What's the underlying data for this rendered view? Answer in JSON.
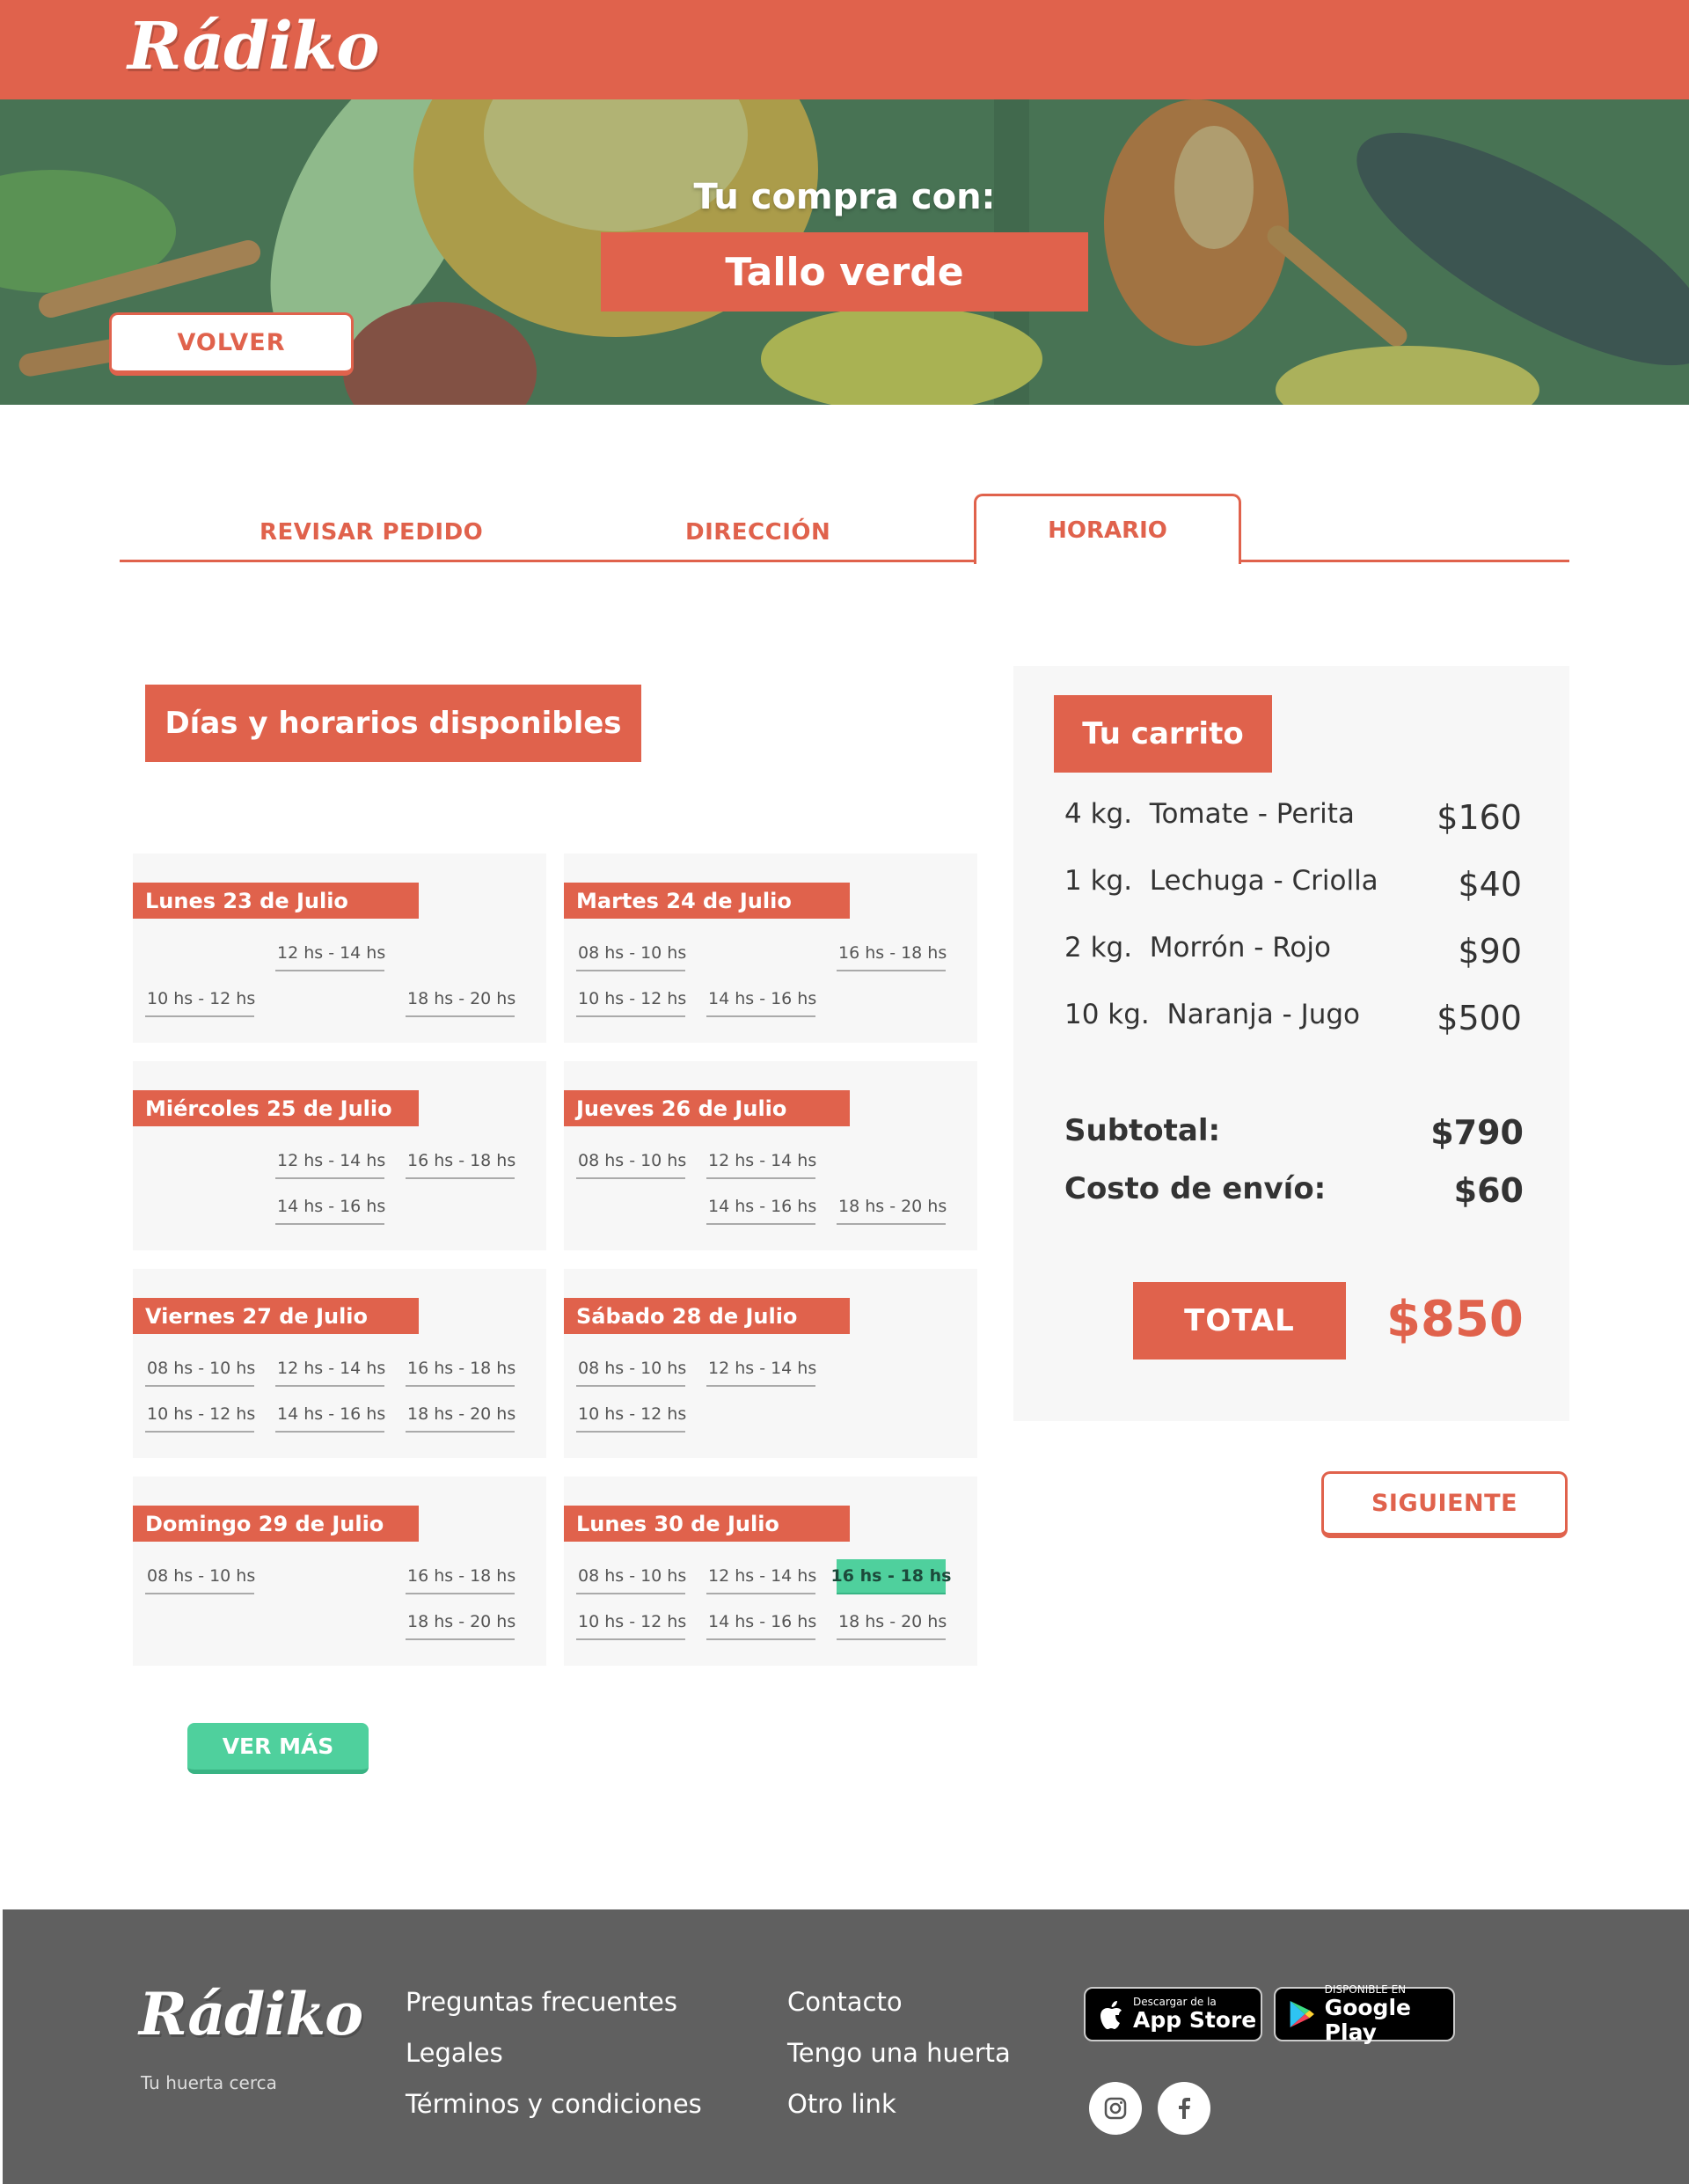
{
  "brand": {
    "name": "Rádiko",
    "tagline": "Tu huerta cerca"
  },
  "hero": {
    "subtitle": "Tu compra con:",
    "store": "Tallo verde",
    "back_label": "VOLVER"
  },
  "tabs": [
    {
      "label": "REVISAR PEDIDO",
      "active": false
    },
    {
      "label": "DIRECCIÓN",
      "active": false
    },
    {
      "label": "HORARIO",
      "active": true
    }
  ],
  "schedule": {
    "title": "Días y horarios disponibles",
    "more_label": "VER MÁS",
    "days": [
      {
        "label": "Lunes 23 de Julio",
        "slots": [
          "12 hs - 14 hs",
          "10 hs - 12 hs",
          "18 hs - 20 hs"
        ]
      },
      {
        "label": "Martes 24 de Julio",
        "slots": [
          "08 hs - 10 hs",
          "16 hs - 18 hs",
          "10 hs - 12 hs",
          "14 hs - 16 hs"
        ]
      },
      {
        "label": "Miércoles 25 de Julio",
        "slots": [
          "12 hs - 14 hs",
          "16 hs - 18 hs",
          "14 hs - 16 hs"
        ]
      },
      {
        "label": "Jueves 26 de Julio",
        "slots": [
          "08 hs - 10 hs",
          "12 hs - 14 hs",
          "14 hs - 16 hs",
          "18 hs - 20 hs"
        ]
      },
      {
        "label": "Viernes 27 de Julio",
        "slots": [
          "08 hs - 10 hs",
          "12 hs - 14 hs",
          "16 hs - 18 hs",
          "10 hs - 12 hs",
          "14 hs - 16 hs",
          "18 hs - 20 hs"
        ]
      },
      {
        "label": "Sábado 28 de Julio",
        "slots": [
          "08 hs - 10 hs",
          "12 hs - 14 hs",
          "10 hs - 12 hs"
        ]
      },
      {
        "label": "Domingo 29 de Julio",
        "slots": [
          "08 hs - 10 hs",
          "16 hs - 18 hs",
          "18 hs - 20 hs"
        ]
      },
      {
        "label": "Lunes 30 de Julio",
        "slots": [
          "08 hs - 10 hs",
          "12 hs - 14 hs",
          "16 hs - 18 hs",
          "10 hs - 12 hs",
          "14 hs - 16 hs",
          "18 hs - 20 hs"
        ],
        "selected": "16 hs - 18 hs"
      }
    ]
  },
  "cart": {
    "title": "Tu carrito",
    "items": [
      {
        "qty": "4 kg.",
        "name": "Tomate - Perita",
        "price": "$160"
      },
      {
        "qty": "1 kg.",
        "name": "Lechuga - Criolla",
        "price": "$40"
      },
      {
        "qty": "2 kg.",
        "name": "Morrón - Rojo",
        "price": "$90"
      },
      {
        "qty": "10 kg.",
        "name": "Naranja - Jugo",
        "price": "$500"
      }
    ],
    "subtotal_label": "Subtotal:",
    "subtotal": "$790",
    "shipping_label": "Costo de envío:",
    "shipping": "$60",
    "total_label": "TOTAL",
    "total": "$850",
    "next_label": "SIGUIENTE"
  },
  "footer": {
    "col1": [
      "Preguntas frecuentes",
      "Legales",
      "Términos y condiciones"
    ],
    "col2": [
      "Contacto",
      "Tengo una huerta",
      "Otro link"
    ],
    "app_store": {
      "small": "Descargar de la",
      "big": "App Store"
    },
    "google_play": {
      "small": "DISPONIBLE EN",
      "big": "Google Play"
    },
    "social": [
      "instagram-icon",
      "facebook-icon"
    ]
  },
  "colors": {
    "brand": "#e0624c",
    "accent": "#4fd09d",
    "footer": "#606060",
    "card": "#f7f7f7"
  }
}
